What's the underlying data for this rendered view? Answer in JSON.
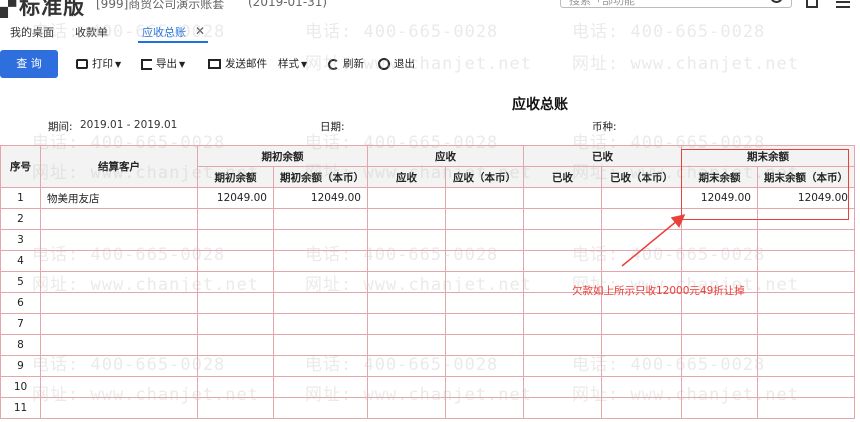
{
  "app": {
    "logo": "标准版",
    "account": "[999]商贸公司演示账套",
    "date": "(2019-01-31)",
    "search_placeholder": "搜索「部功能"
  },
  "tabs": [
    "我的桌面",
    "收款单",
    "应收总账"
  ],
  "toolbar": {
    "query": "查 询",
    "print": "打印",
    "export": "导出",
    "send_mail": "发送邮件",
    "style": "样式",
    "refresh": "刷新",
    "exit": "退出"
  },
  "report": {
    "title": "应收总账",
    "period_label": "期间:",
    "period_value": "2019.01 - 2019.01",
    "date_label": "日期:",
    "currency_label": "币种:"
  },
  "table": {
    "headers": {
      "seq": "序号",
      "customer": "结算客户",
      "opening": "期初余额",
      "receivable": "应收",
      "received": "已收",
      "closing": "期末余额"
    },
    "sub_headers": [
      "期初余额",
      "期初余额（本币）",
      "应收",
      "应收（本币）",
      "已收",
      "已收（本币）",
      "期末余额",
      "期末余额（本币）"
    ],
    "rows": [
      {
        "no": "1",
        "customer": "物美用友店",
        "cells": [
          "12049.00",
          "12049.00",
          "",
          "",
          "",
          "",
          "12049.00",
          "12049.00"
        ]
      },
      {
        "no": "2",
        "customer": "",
        "cells": [
          "",
          "",
          "",
          "",
          "",
          "",
          "",
          ""
        ]
      },
      {
        "no": "3",
        "customer": "",
        "cells": [
          "",
          "",
          "",
          "",
          "",
          "",
          "",
          ""
        ]
      },
      {
        "no": "4",
        "customer": "",
        "cells": [
          "",
          "",
          "",
          "",
          "",
          "",
          "",
          ""
        ]
      },
      {
        "no": "5",
        "customer": "",
        "cells": [
          "",
          "",
          "",
          "",
          "",
          "",
          "",
          ""
        ]
      },
      {
        "no": "6",
        "customer": "",
        "cells": [
          "",
          "",
          "",
          "",
          "",
          "",
          "",
          ""
        ]
      },
      {
        "no": "7",
        "customer": "",
        "cells": [
          "",
          "",
          "",
          "",
          "",
          "",
          "",
          ""
        ]
      },
      {
        "no": "8",
        "customer": "",
        "cells": [
          "",
          "",
          "",
          "",
          "",
          "",
          "",
          ""
        ]
      },
      {
        "no": "9",
        "customer": "",
        "cells": [
          "",
          "",
          "",
          "",
          "",
          "",
          "",
          ""
        ]
      },
      {
        "no": "10",
        "customer": "",
        "cells": [
          "",
          "",
          "",
          "",
          "",
          "",
          "",
          ""
        ]
      },
      {
        "no": "11",
        "customer": "",
        "cells": [
          "",
          "",
          "",
          "",
          "",
          "",
          "",
          ""
        ]
      }
    ]
  },
  "annotation": {
    "note": "欠款如上所示只收12000元49折让掉",
    "color": "#e9403a"
  },
  "watermark": {
    "phone": "电话: 400-665-0028",
    "site": "网址: www.chanjet.net"
  },
  "colors": {
    "accent": "#2f6fdd",
    "active_tab": "#1e6fe0",
    "table_border": "#e3a6ab"
  }
}
